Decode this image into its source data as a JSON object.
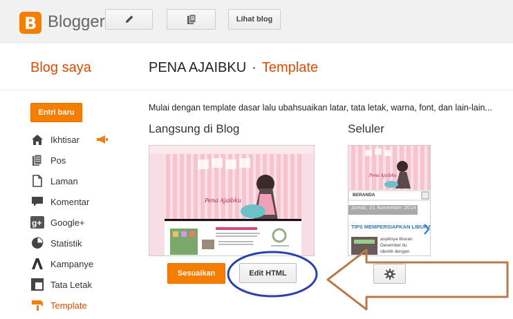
{
  "app": {
    "name": "Blogger",
    "logo_letter": "B"
  },
  "toolbar": {
    "edit_icon": "pencil-icon",
    "posts_icon": "pages-icon",
    "view_blog_label": "Lihat blog"
  },
  "nav": {
    "title": "Blog saya"
  },
  "breadcrumb": {
    "blog_name": "PENA AJAIBKU",
    "separator": "·",
    "current": "Template"
  },
  "sidebar": {
    "new_post_label": "Entri baru",
    "items": [
      {
        "label": "Ikhtisar",
        "icon": "home-icon"
      },
      {
        "label": "Pos",
        "icon": "posts-icon"
      },
      {
        "label": "Laman",
        "icon": "page-icon"
      },
      {
        "label": "Komentar",
        "icon": "comment-icon"
      },
      {
        "label": "Google+",
        "icon": "google-plus-icon"
      },
      {
        "label": "Statistik",
        "icon": "stats-icon"
      },
      {
        "label": "Kampanye",
        "icon": "campaign-icon"
      },
      {
        "label": "Tata Letak",
        "icon": "layout-icon"
      },
      {
        "label": "Template",
        "icon": "template-icon",
        "active": true
      }
    ]
  },
  "main": {
    "description": "Mulai dengan template dasar lalu ubahsuaikan latar, tata letak, warna, font, dan lain-lain...",
    "live": {
      "title": "Langsung di Blog",
      "preview_blog_title": "Pena Ajaibku",
      "customize_label": "Sesuaikan",
      "edit_html_label": "Edit HTML"
    },
    "mobile": {
      "title": "Seluler",
      "preview_blog_title": "Pena Ajaibku",
      "menu_label": "BERANDA",
      "date_label": "Jumat, 21 November 2014",
      "post_title": "TIPS MEMPERSIAPKAN LIBURAN",
      "snippet": "asyiknya liburan Desember itu identik dengan",
      "settings_icon": "gear-icon"
    }
  },
  "colors": {
    "accent": "#f57d00",
    "accent_text": "#dd4b00",
    "annotation_circle": "#2b3fb0",
    "annotation_arrow": "#b87a4b"
  }
}
